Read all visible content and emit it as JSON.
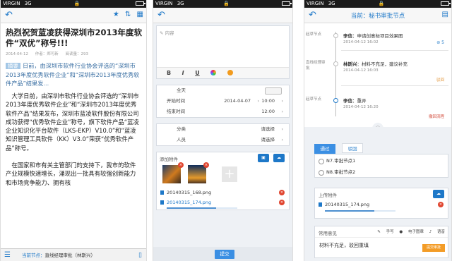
{
  "status": {
    "carrier": "VIRGIN",
    "network": "3G",
    "lock": "🔒"
  },
  "screen1": {
    "title": "热烈祝贺蓝凌获得深圳市2013年度软件“双优”称号!!!",
    "meta": {
      "date": "2014-04-12",
      "author_label": "作者：",
      "author": "郑可新",
      "views_label": "阅读量：",
      "views": "293"
    },
    "summary_tag": "摘要",
    "summary": "日前，由深圳市软件行业协会评选的“深圳市2013年度优秀软件企业”和“深圳市2013年度优秀软件产品”结果发...",
    "paragraphs": [
      "大学日前，由深圳市软件行业协会评选的“深圳市2013年度优秀软件企业”和“深圳市2013年度优秀软件产品”结果发布，深圳市蓝凌软件股份有限公司成功获得“优秀软件企业”称号，旗下软件产品“蓝凌企业知识化平台软件（LKS-EKP）V10.0”和“蓝凌知识管理工具软件（KK）V3.0”荣获“优秀软件产品”称号。",
      "在国家和市有关主管部门的支持下，我市的软件产业规模快速增长，涌现出一批具有较强创新能力和市场竞争能力、拥有核"
    ],
    "bottom": {
      "node_label": "当前节点：",
      "node_value": "直线经理审批",
      "node_person": "（林斯兴）"
    }
  },
  "screen2": {
    "content_placeholder": "内容",
    "format": {
      "bold": "B",
      "italic": "I",
      "underline": "U"
    },
    "rows": [
      {
        "label": "全天",
        "value": ""
      },
      {
        "label": "开始时间",
        "value": "2014-04-07",
        "value2": "10:00"
      },
      {
        "label": "结束时间",
        "value": "",
        "value2": "12:00"
      }
    ],
    "category": {
      "label": "分类",
      "value": "请选择"
    },
    "person": {
      "label": "人员",
      "value": "请选择"
    },
    "attach_label": "添加附件",
    "files": [
      "20140315_168.png",
      "20140315_174.png"
    ],
    "upload_progress": 0.7,
    "submit": "提交"
  },
  "screen3": {
    "header": "当前：秘书审批节点",
    "timeline": [
      {
        "label": "起草节点",
        "who": "李信",
        "text": "申请创意标项目效果图",
        "time": "2014-04-12  16:02",
        "clip": "5"
      },
      {
        "label": "直线经理审批",
        "who": "林斯兴",
        "text": "材料不充足，建议补充",
        "time": "2014-04-12  16:03",
        "tag": "驳回"
      },
      {
        "label": "起草节点",
        "who": "李信",
        "text": "重弄",
        "time": "2014-04-12  16:20",
        "tag": "撤回流程"
      }
    ],
    "tabs": {
      "pass": "通过",
      "reject": "驳回"
    },
    "choices": [
      "N7.审批节点1",
      "N8.审批节点2"
    ],
    "upload_label": "上传附件",
    "upload_file": "20140315_174.png",
    "common_label": "常用意见",
    "tools": {
      "handwrite": "手写",
      "signature": "电子图章",
      "voice": "语音"
    },
    "opinion_text": "材料不充足，驳回重填",
    "send": "提交审批"
  }
}
